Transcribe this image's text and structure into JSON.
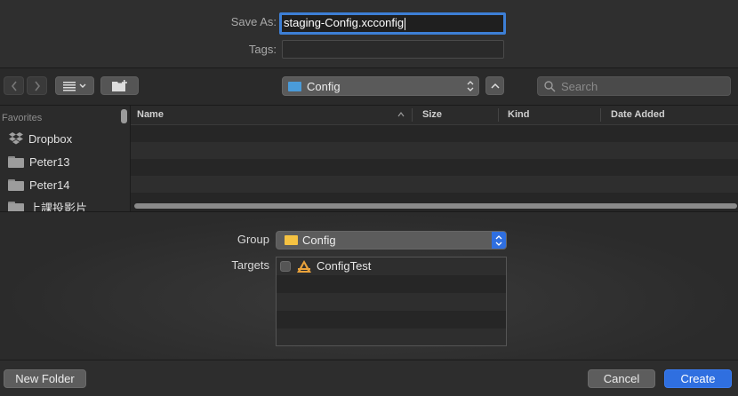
{
  "save_as": {
    "label": "Save As:",
    "value": "staging-Config.xcconfig"
  },
  "tags": {
    "label": "Tags:",
    "value": ""
  },
  "toolbar": {
    "back_icon": "chevron-left-icon",
    "forward_icon": "chevron-right-icon",
    "view_icon": "list-view-icon",
    "new_folder_icon": "new-folder-icon",
    "location": "Config",
    "search_placeholder": "Search"
  },
  "sidebar": {
    "heading": "Favorites",
    "items": [
      {
        "label": "Dropbox",
        "icon": "dropbox-icon"
      },
      {
        "label": "Peter13",
        "icon": "folder-icon"
      },
      {
        "label": "Peter14",
        "icon": "folder-icon"
      },
      {
        "label": "上課投影片",
        "icon": "folder-icon"
      }
    ]
  },
  "file_list": {
    "columns": [
      "Name",
      "Size",
      "Kind",
      "Date Added"
    ],
    "rows": []
  },
  "options": {
    "group_label": "Group",
    "group_value": "Config",
    "targets_label": "Targets",
    "targets": [
      {
        "name": "ConfigTest",
        "checked": false
      }
    ]
  },
  "footer": {
    "new_folder": "New Folder",
    "cancel": "Cancel",
    "create": "Create"
  },
  "colors": {
    "accent": "#2f6fe0",
    "focus_ring": "#3d7fd6",
    "folder": "#f5c242"
  }
}
